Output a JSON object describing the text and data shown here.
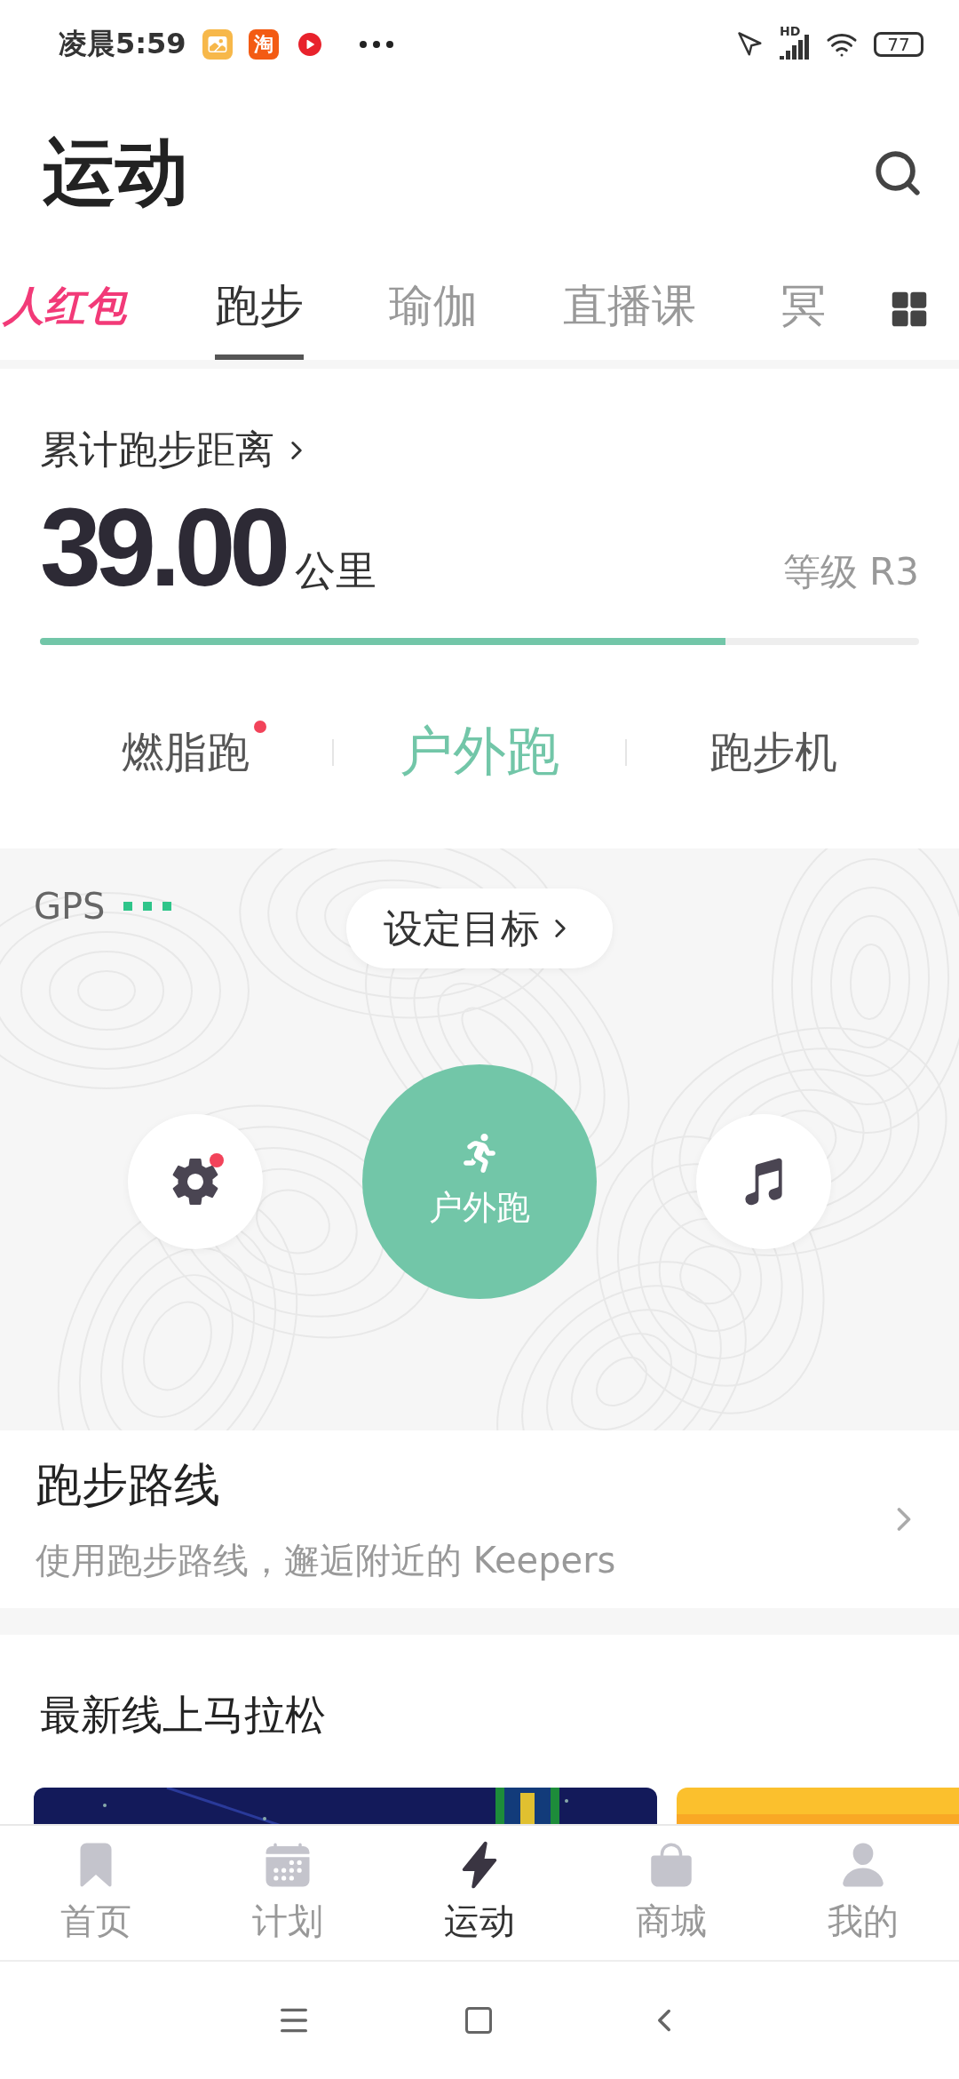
{
  "status_bar": {
    "time": "凌晨5:59",
    "notifications": [
      {
        "kind": "gallery"
      },
      {
        "kind": "shop",
        "label": "淘"
      },
      {
        "kind": "video"
      }
    ],
    "network_label": "HD",
    "battery": "77"
  },
  "header": {
    "title": "运动"
  },
  "tabs": [
    {
      "label": "人红包",
      "kind": "promo",
      "selected": false
    },
    {
      "label": "跑步",
      "kind": "tab",
      "selected": true
    },
    {
      "label": "瑜伽",
      "kind": "tab",
      "selected": false
    },
    {
      "label": "直播课",
      "kind": "tab",
      "selected": false
    },
    {
      "label": "冥",
      "kind": "tab",
      "selected": false
    }
  ],
  "distance": {
    "label": "累计跑步距离",
    "value": "39.00",
    "unit": "公里",
    "grade": "等级 R3",
    "level": 0.78
  },
  "modes": [
    {
      "label": "燃脂跑",
      "selected": false,
      "badge": true
    },
    {
      "label": "户外跑",
      "selected": true,
      "badge": false
    },
    {
      "label": "跑步机",
      "selected": false,
      "badge": false
    }
  ],
  "map": {
    "gps_label": "GPS",
    "goal_button": "设定目标",
    "start_label": "户外跑",
    "settings_badge": true
  },
  "route": {
    "title": "跑步路线",
    "subtitle": "使用跑步路线，邂逅附近的 Keepers"
  },
  "marathon": {
    "title": "最新线上马拉松"
  },
  "bottom_nav": [
    {
      "label": "首页",
      "selected": false
    },
    {
      "label": "计划",
      "selected": false
    },
    {
      "label": "运动",
      "selected": true
    },
    {
      "label": "商城",
      "selected": false
    },
    {
      "label": "我的",
      "selected": false
    }
  ]
}
